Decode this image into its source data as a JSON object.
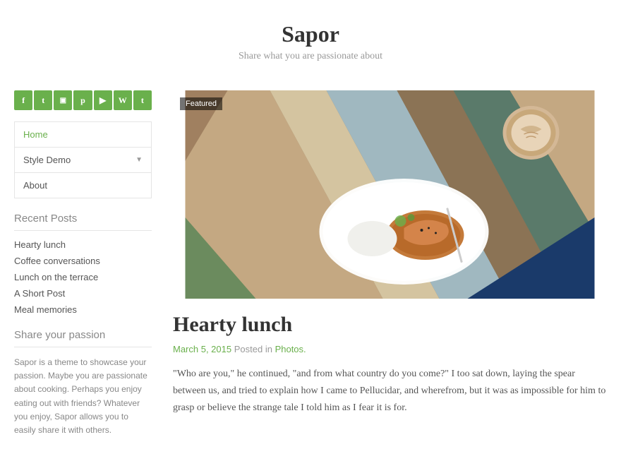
{
  "header": {
    "site_title": "Sapor",
    "site_tagline": "Share what you are passionate about"
  },
  "sidebar": {
    "social_icons": [
      {
        "name": "facebook",
        "label": "f"
      },
      {
        "name": "twitter",
        "label": "t"
      },
      {
        "name": "instagram",
        "label": "📷"
      },
      {
        "name": "pinterest",
        "label": "p"
      },
      {
        "name": "youtube",
        "label": "▶"
      },
      {
        "name": "wordpress",
        "label": "W"
      },
      {
        "name": "tumblr",
        "label": "t"
      }
    ],
    "nav_items": [
      {
        "label": "Home",
        "active": true
      },
      {
        "label": "Style Demo",
        "has_dropdown": true
      },
      {
        "label": "About",
        "active": false
      }
    ],
    "recent_posts_title": "Recent Posts",
    "recent_posts": [
      {
        "label": "Hearty lunch"
      },
      {
        "label": "Coffee conversations"
      },
      {
        "label": "Lunch on the terrace"
      },
      {
        "label": "A Short Post"
      },
      {
        "label": "Meal memories"
      }
    ],
    "share_section_title": "Share your passion",
    "share_description": "Sapor is a theme to showcase your passion. Maybe you are passionate about cooking. Perhaps you enjoy eating out with friends? Whatever you enjoy, Sapor allows you to easily share it with others."
  },
  "main": {
    "featured_badge": "Featured",
    "post_title": "Hearty lunch",
    "post_date": "March 5, 2015",
    "post_meta_prefix": "Posted in",
    "post_category": "Photos.",
    "post_excerpt": "\"Who are you,\" he continued, \"and from what country do you come?\" I too sat down, laying the spear between us, and tried to explain how I came to Pellucidar, and wherefrom, but it was as impossible for him to grasp or believe the strange tale I told him as I fear it is for."
  }
}
